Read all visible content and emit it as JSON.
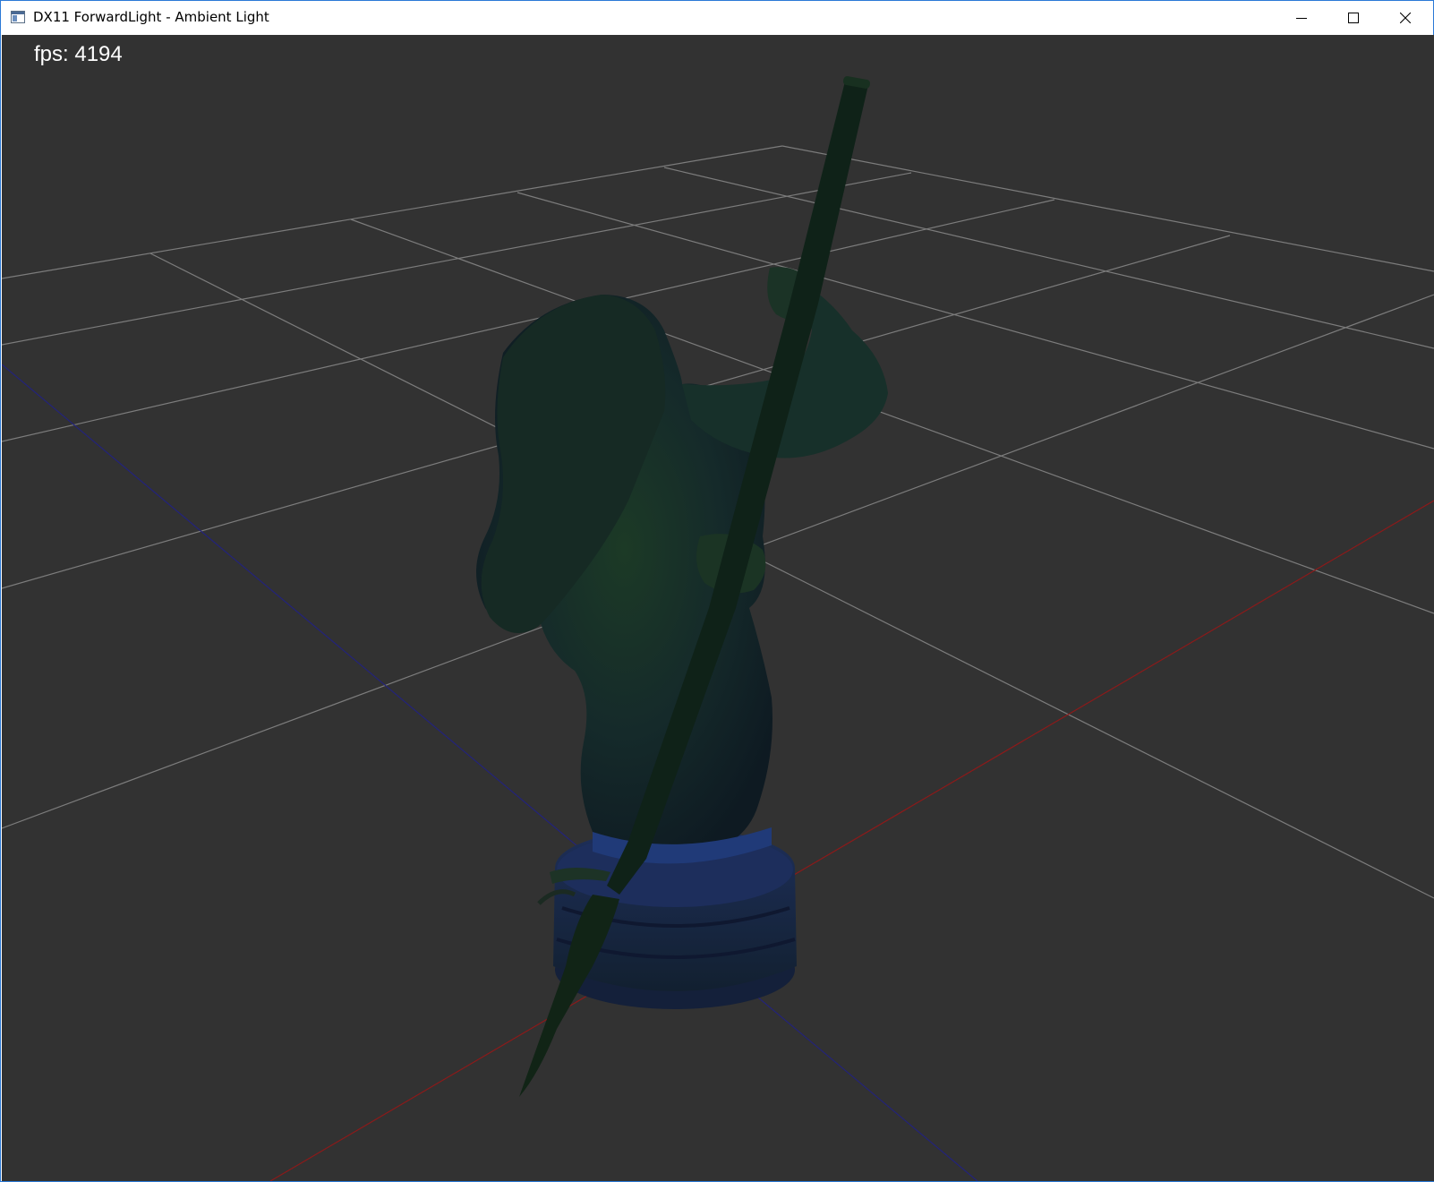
{
  "window": {
    "title": "DX11 ForwardLight - Ambient Light",
    "icon": "app-window-icon",
    "controls": {
      "minimize_icon": "minimize-icon",
      "maximize_icon": "maximize-icon",
      "close_icon": "close-icon"
    }
  },
  "viewport": {
    "fps_text": "fps: 4194",
    "background_color": "#323232",
    "grid_color": "#8a8a8a",
    "x_axis_color": "#8b1a1a",
    "z_axis_color": "#23237a",
    "model": "statue-model"
  }
}
